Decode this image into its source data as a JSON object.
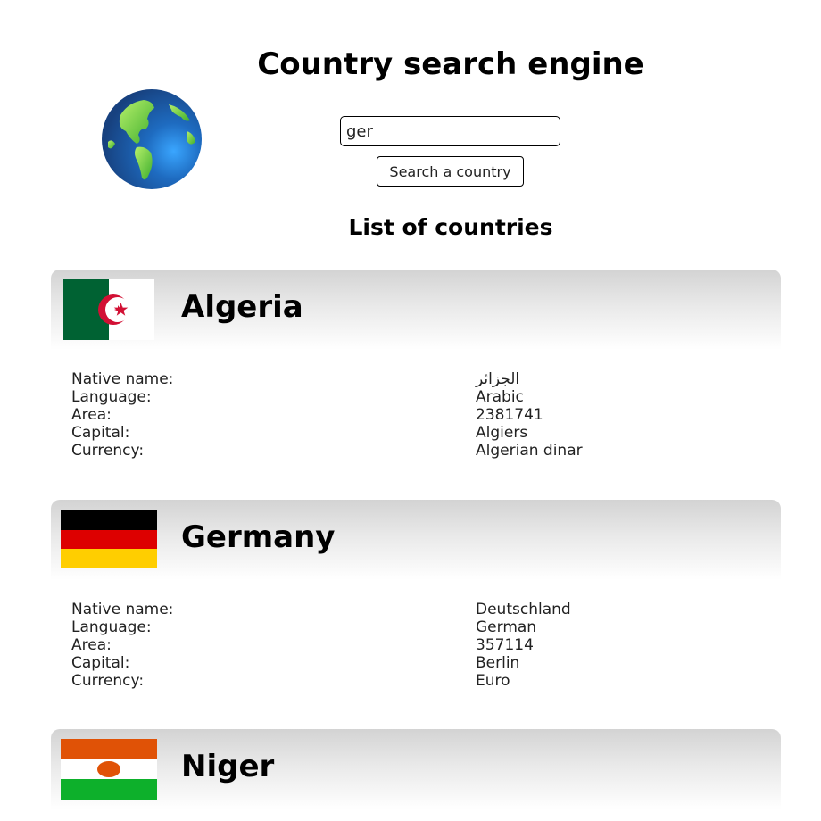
{
  "header": {
    "title": "Country search engine",
    "logo_icon": "globe-icon"
  },
  "search": {
    "value": "ger",
    "button_label": "Search a country"
  },
  "list": {
    "heading": "List of countries",
    "countries": [
      {
        "name": "Algeria",
        "flag_icon": "algeria-flag-icon",
        "details": [
          {
            "label": "Native name:",
            "value": "الجزائر"
          },
          {
            "label": "Language:",
            "value": "Arabic"
          },
          {
            "label": "Area:",
            "value": "2381741"
          },
          {
            "label": "Capital:",
            "value": "Algiers"
          },
          {
            "label": "Currency:",
            "value": "Algerian dinar"
          }
        ]
      },
      {
        "name": "Germany",
        "flag_icon": "germany-flag-icon",
        "details": [
          {
            "label": "Native name:",
            "value": "Deutschland"
          },
          {
            "label": "Language:",
            "value": "German"
          },
          {
            "label": "Area:",
            "value": "357114"
          },
          {
            "label": "Capital:",
            "value": "Berlin"
          },
          {
            "label": "Currency:",
            "value": "Euro"
          }
        ]
      },
      {
        "name": "Niger",
        "flag_icon": "niger-flag-icon",
        "details": []
      }
    ]
  },
  "colors": {
    "algeria_green": "#006233",
    "algeria_red": "#d21034",
    "germany_black": "#000000",
    "germany_red": "#dd0000",
    "germany_gold": "#ffce00",
    "niger_orange": "#e05206",
    "niger_green": "#0db02b",
    "globe_ocean": "#1e5aa8",
    "globe_land": "#7ed957"
  }
}
